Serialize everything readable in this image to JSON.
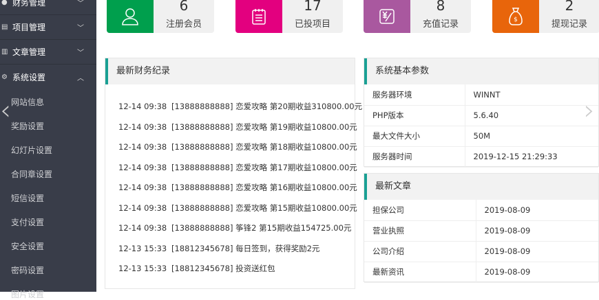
{
  "sidebar": {
    "menus": [
      {
        "label": "财务管理",
        "icon": "yen-circle-icon",
        "expanded": false
      },
      {
        "label": "项目管理",
        "icon": "list-icon",
        "expanded": false
      },
      {
        "label": "文章管理",
        "icon": "document-icon",
        "expanded": false
      },
      {
        "label": "系统设置",
        "icon": "gear-icon",
        "expanded": true
      }
    ],
    "sub_items": [
      "网站信息",
      "奖励设置",
      "幻灯片设置",
      "合同章设置",
      "短信设置",
      "支付设置",
      "安全设置",
      "密码设置",
      "图片设置"
    ]
  },
  "stats": [
    {
      "num": "6",
      "label": "注册会员",
      "color": "#009f4d",
      "icon": "user-icon"
    },
    {
      "num": "17",
      "label": "已投项目",
      "color": "#e3007f",
      "icon": "clipboard-icon"
    },
    {
      "num": "8",
      "label": "充值记录",
      "color": "#a9589f",
      "icon": "recharge-icon"
    },
    {
      "num": "2",
      "label": "提现记录",
      "color": "#e8650b",
      "icon": "money-bag-icon"
    }
  ],
  "finance": {
    "title": "最新财务纪录",
    "records": [
      {
        "time": "12-14 09:38",
        "text": "[13888888888] 恋爱攻略 第20期收益310800.00元"
      },
      {
        "time": "12-14 09:38",
        "text": "[13888888888] 恋爱攻略 第19期收益10800.00元"
      },
      {
        "time": "12-14 09:38",
        "text": "[13888888888] 恋爱攻略 第18期收益10800.00元"
      },
      {
        "time": "12-14 09:38",
        "text": "[13888888888] 恋爱攻略 第17期收益10800.00元"
      },
      {
        "time": "12-14 09:38",
        "text": "[13888888888] 恋爱攻略 第16期收益10800.00元"
      },
      {
        "time": "12-14 09:38",
        "text": "[13888888888] 恋爱攻略 第15期收益10800.00元"
      },
      {
        "time": "12-14 09:38",
        "text": "[13888888888] 筝锋2 第15期收益154725.00元"
      },
      {
        "time": "12-13 15:33",
        "text": "[18812345678] 每日签到，获得奖励2元"
      },
      {
        "time": "12-13 15:33",
        "text": "[18812345678] 投资送红包"
      }
    ]
  },
  "system": {
    "title": "系统基本参数",
    "rows": [
      {
        "k": "服务器环境",
        "v": "WINNT"
      },
      {
        "k": "PHP版本",
        "v": "5.6.40"
      },
      {
        "k": "最大文件大小",
        "v": "50M"
      },
      {
        "k": "服务器时间",
        "v": "2019-12-15 21:29:33"
      }
    ]
  },
  "articles": {
    "title": "最新文章",
    "rows": [
      {
        "k": "担保公司",
        "v": "2019-08-09"
      },
      {
        "k": "营业执照",
        "v": "2019-08-09"
      },
      {
        "k": "公司介绍",
        "v": "2019-08-09"
      },
      {
        "k": "最新资讯",
        "v": "2019-08-09"
      }
    ]
  },
  "carousel": {
    "prev": "‹",
    "next": "›"
  }
}
